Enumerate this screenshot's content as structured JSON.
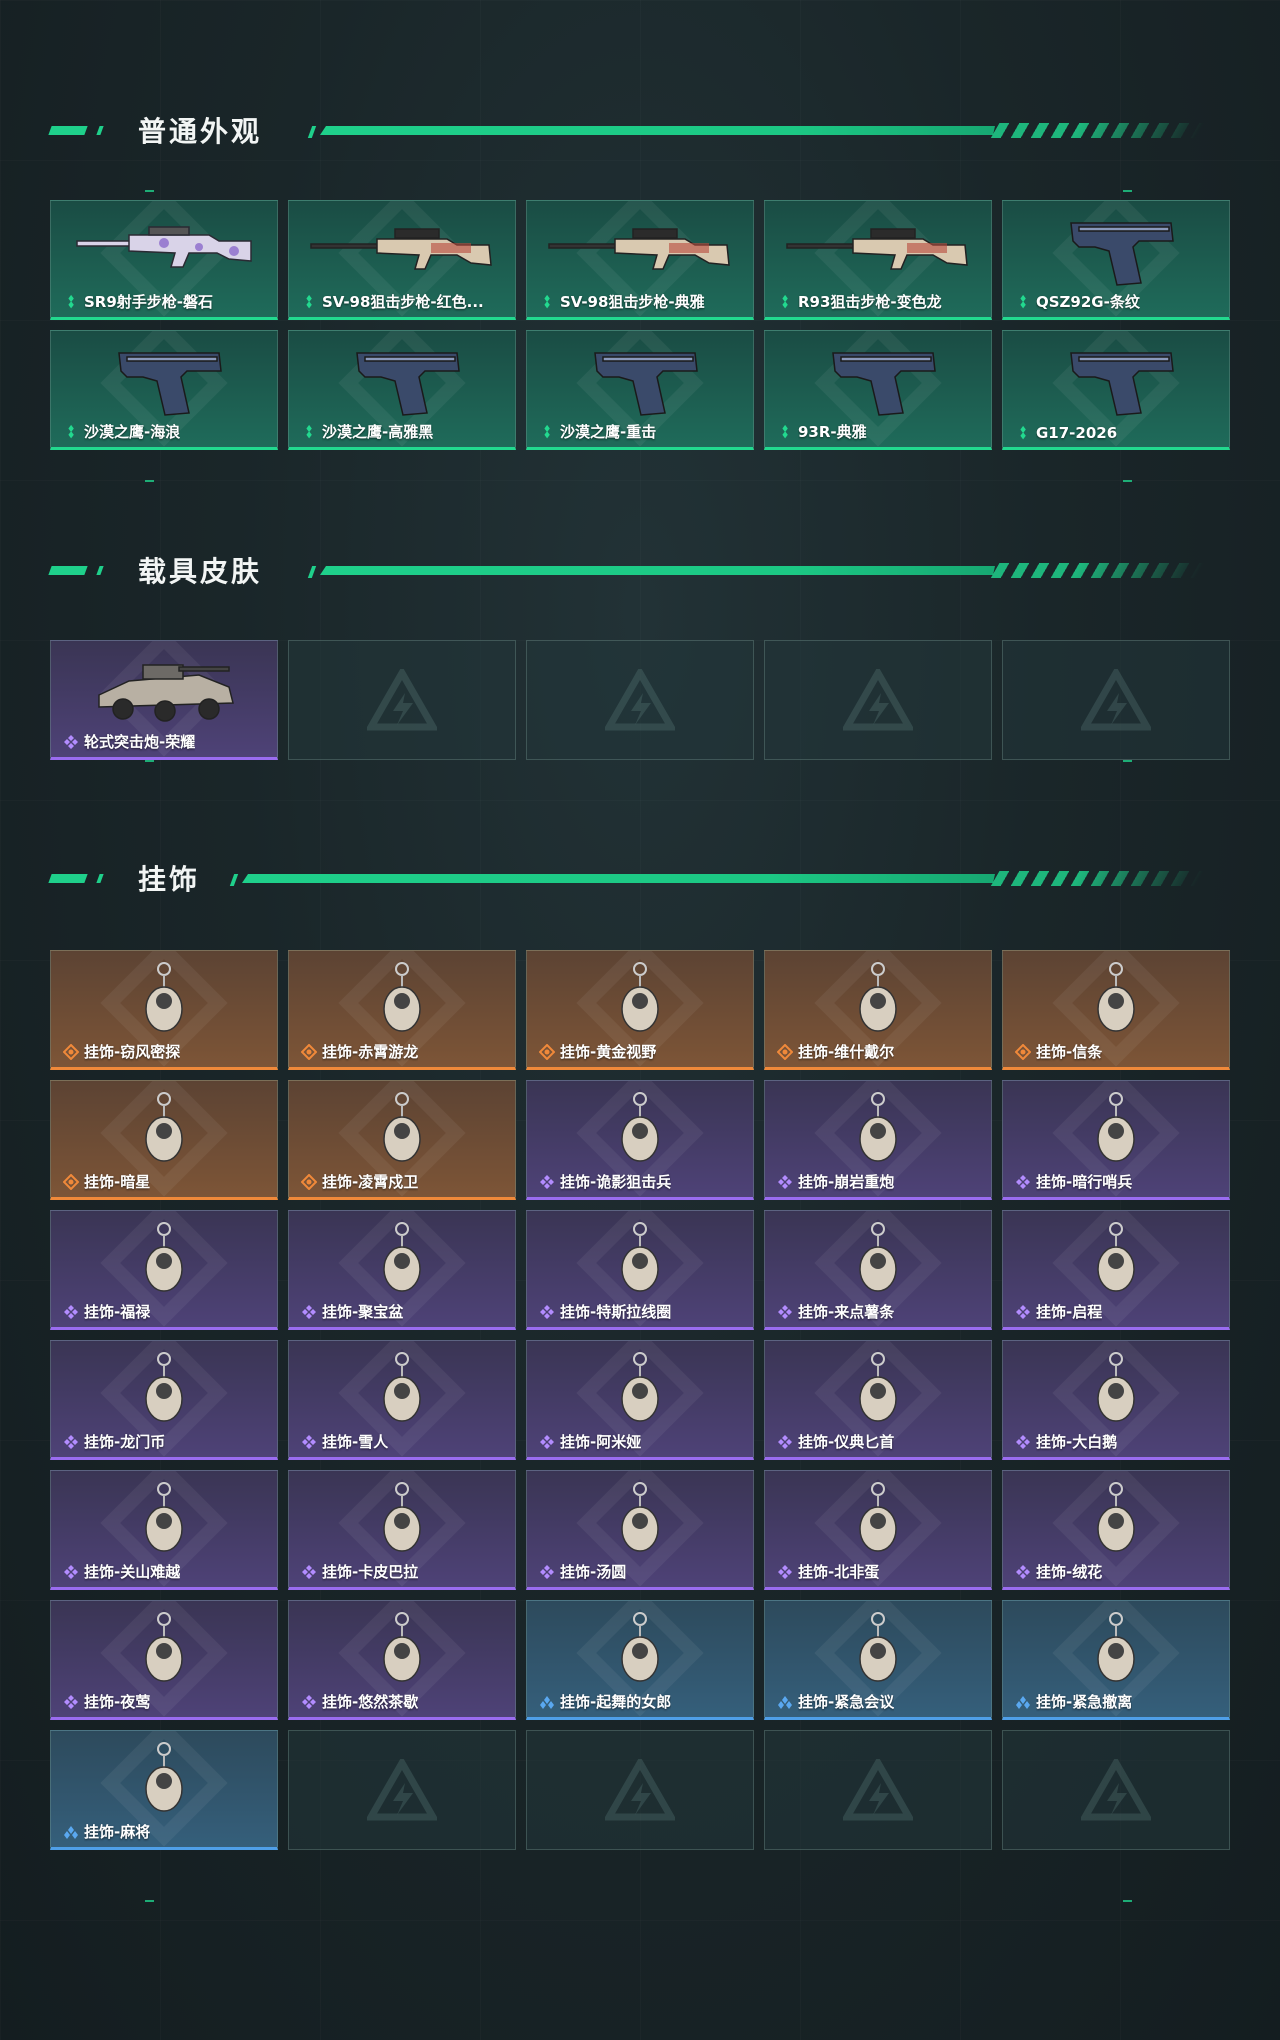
{
  "sections": {
    "weapon": {
      "title": "普通外观",
      "items": [
        {
          "label": "SR9射手步枪-磐石",
          "quality": "green",
          "icon": "rifle-icon"
        },
        {
          "label": "SV-98狙击步枪-红色...",
          "quality": "green",
          "icon": "sniper-rifle-icon"
        },
        {
          "label": "SV-98狙击步枪-典雅",
          "quality": "green",
          "icon": "sniper-rifle-icon"
        },
        {
          "label": "R93狙击步枪-变色龙",
          "quality": "green",
          "icon": "sniper-rifle-icon"
        },
        {
          "label": "QSZ92G-条纹",
          "quality": "green",
          "icon": "pistol-icon"
        },
        {
          "label": "沙漠之鹰-海浪",
          "quality": "green",
          "icon": "pistol-icon"
        },
        {
          "label": "沙漠之鹰-高雅黑",
          "quality": "green",
          "icon": "pistol-icon"
        },
        {
          "label": "沙漠之鹰-重击",
          "quality": "green",
          "icon": "pistol-icon"
        },
        {
          "label": "93R-典雅",
          "quality": "green",
          "icon": "pistol-icon"
        },
        {
          "label": "G17-2026",
          "quality": "green",
          "icon": "pistol-icon"
        }
      ]
    },
    "vehicle": {
      "title": "载具皮肤",
      "items": [
        {
          "label": "轮式突击炮-荣耀",
          "quality": "purple",
          "icon": "armored-vehicle-icon"
        },
        {
          "label": "",
          "quality": "empty"
        },
        {
          "label": "",
          "quality": "empty"
        },
        {
          "label": "",
          "quality": "empty"
        },
        {
          "label": "",
          "quality": "empty"
        }
      ]
    },
    "charm": {
      "title": "挂饰",
      "items": [
        {
          "label": "挂饰-窃风密探",
          "quality": "orange",
          "icon": "charm-icon"
        },
        {
          "label": "挂饰-赤霄游龙",
          "quality": "orange",
          "icon": "charm-icon"
        },
        {
          "label": "挂饰-黄金视野",
          "quality": "orange",
          "icon": "charm-icon"
        },
        {
          "label": "挂饰-维什戴尔",
          "quality": "orange",
          "icon": "charm-icon"
        },
        {
          "label": "挂饰-信条",
          "quality": "orange",
          "icon": "charm-icon"
        },
        {
          "label": "挂饰-暗星",
          "quality": "orange",
          "icon": "charm-icon"
        },
        {
          "label": "挂饰-凌霄戍卫",
          "quality": "orange",
          "icon": "charm-icon"
        },
        {
          "label": "挂饰-诡影狙击兵",
          "quality": "purple",
          "icon": "charm-icon"
        },
        {
          "label": "挂饰-崩岩重炮",
          "quality": "purple",
          "icon": "charm-icon"
        },
        {
          "label": "挂饰-暗行哨兵",
          "quality": "purple",
          "icon": "charm-icon"
        },
        {
          "label": "挂饰-福禄",
          "quality": "purple",
          "icon": "charm-icon"
        },
        {
          "label": "挂饰-聚宝盆",
          "quality": "purple",
          "icon": "charm-icon"
        },
        {
          "label": "挂饰-特斯拉线圈",
          "quality": "purple",
          "icon": "charm-icon"
        },
        {
          "label": "挂饰-来点薯条",
          "quality": "purple",
          "icon": "charm-icon"
        },
        {
          "label": "挂饰-启程",
          "quality": "purple",
          "icon": "charm-icon"
        },
        {
          "label": "挂饰-龙门币",
          "quality": "purple",
          "icon": "charm-icon"
        },
        {
          "label": "挂饰-雪人",
          "quality": "purple",
          "icon": "charm-icon"
        },
        {
          "label": "挂饰-阿米娅",
          "quality": "purple",
          "icon": "charm-icon"
        },
        {
          "label": "挂饰-仪典匕首",
          "quality": "purple",
          "icon": "charm-icon"
        },
        {
          "label": "挂饰-大白鹅",
          "quality": "purple",
          "icon": "charm-icon"
        },
        {
          "label": "挂饰-关山难越",
          "quality": "purple",
          "icon": "charm-icon"
        },
        {
          "label": "挂饰-卡皮巴拉",
          "quality": "purple",
          "icon": "charm-icon"
        },
        {
          "label": "挂饰-汤圆",
          "quality": "purple",
          "icon": "charm-icon"
        },
        {
          "label": "挂饰-北非蛋",
          "quality": "purple",
          "icon": "charm-icon"
        },
        {
          "label": "挂饰-绒花",
          "quality": "purple",
          "icon": "charm-icon"
        },
        {
          "label": "挂饰-夜莺",
          "quality": "purple",
          "icon": "charm-icon"
        },
        {
          "label": "挂饰-悠然茶歇",
          "quality": "purple",
          "icon": "charm-icon"
        },
        {
          "label": "挂饰-起舞的女郎",
          "quality": "blue",
          "icon": "charm-icon"
        },
        {
          "label": "挂饰-紧急会议",
          "quality": "blue",
          "icon": "charm-icon"
        },
        {
          "label": "挂饰-紧急撤离",
          "quality": "blue",
          "icon": "charm-icon"
        },
        {
          "label": "挂饰-麻将",
          "quality": "blue",
          "icon": "charm-icon"
        },
        {
          "label": "",
          "quality": "empty"
        },
        {
          "label": "",
          "quality": "empty"
        },
        {
          "label": "",
          "quality": "empty"
        },
        {
          "label": "",
          "quality": "empty"
        }
      ]
    }
  },
  "colors": {
    "accent": "#1fd08b",
    "green": "#22d98f",
    "purple": "#9a6cf0",
    "orange": "#f0893a",
    "blue": "#4f9fe8"
  }
}
